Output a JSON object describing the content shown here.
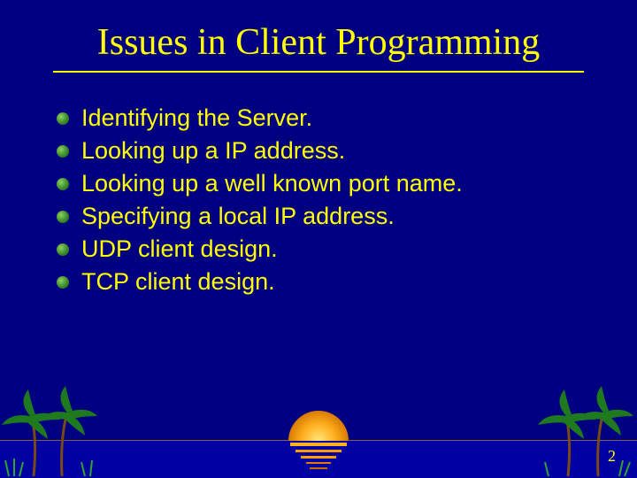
{
  "title": "Issues in Client Programming",
  "bullets": [
    "Identifying the Server.",
    "Looking up a IP address.",
    "Looking up a well known port name.",
    "Specifying a local IP address.",
    "UDP client design.",
    "TCP client design."
  ],
  "page_number": "2",
  "colors": {
    "background": "#000080",
    "text": "#ffff00"
  }
}
